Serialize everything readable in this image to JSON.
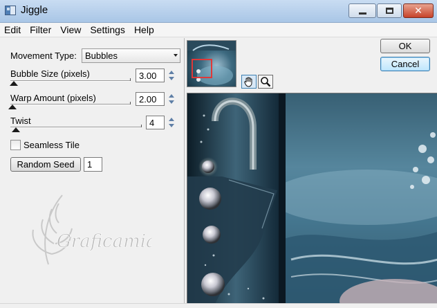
{
  "window": {
    "title": "Jiggle"
  },
  "menu": [
    "Edit",
    "Filter",
    "View",
    "Settings",
    "Help"
  ],
  "controls": {
    "movement_type": {
      "label": "Movement Type:",
      "value": "Bubbles"
    },
    "bubble_size": {
      "label": "Bubble Size (pixels)",
      "value": "3.00",
      "level": 0.03
    },
    "warp_amount": {
      "label": "Warp Amount (pixels)",
      "value": "2.00",
      "level": 0.02
    },
    "twist": {
      "label": "Twist",
      "value": "4",
      "level": 0.04
    },
    "seamless_tile": {
      "label": "Seamless Tile",
      "checked": false
    },
    "random_seed": {
      "button_label": "Random Seed",
      "value": "1"
    }
  },
  "buttons": {
    "ok": "OK",
    "cancel": "Cancel"
  },
  "watermark_text": "Graficamia",
  "icons": [
    "app-icon",
    "minimize-icon",
    "maximize-icon",
    "close-icon",
    "dropdown-arrow-icon",
    "spin-up-icon",
    "spin-down-icon",
    "hand-pan-icon",
    "magnifier-zoom-icon"
  ],
  "colors": {
    "titlebar": "#b9d1ec",
    "close_button": "#c7432a",
    "nav_frame": "#e03838",
    "default_button_focus": "#3c7fb1"
  }
}
